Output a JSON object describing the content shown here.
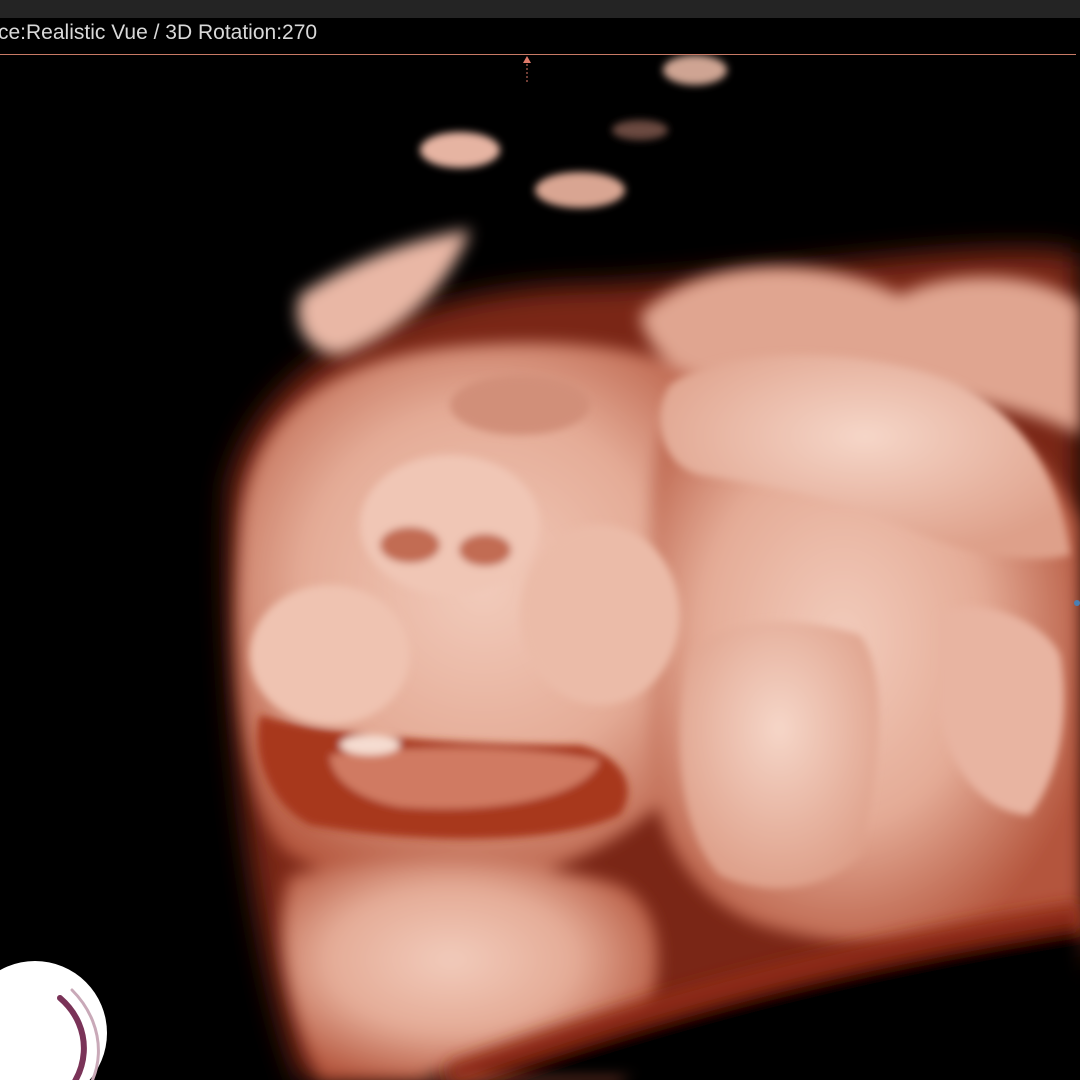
{
  "window": {
    "info_text": "ce:Realistic Vue / 3D Rotation:270"
  },
  "viewport": {
    "render_mode": "3D ultrasound volume render",
    "background_color": "#000000",
    "tissue_color": "#e9b8a6",
    "shadow_color": "#8a2f1c"
  },
  "overlays": {
    "top_marker_icon": "arrow-up-icon",
    "logo_icon": "crescent-logo-icon",
    "accent_color": "#c87a66"
  }
}
